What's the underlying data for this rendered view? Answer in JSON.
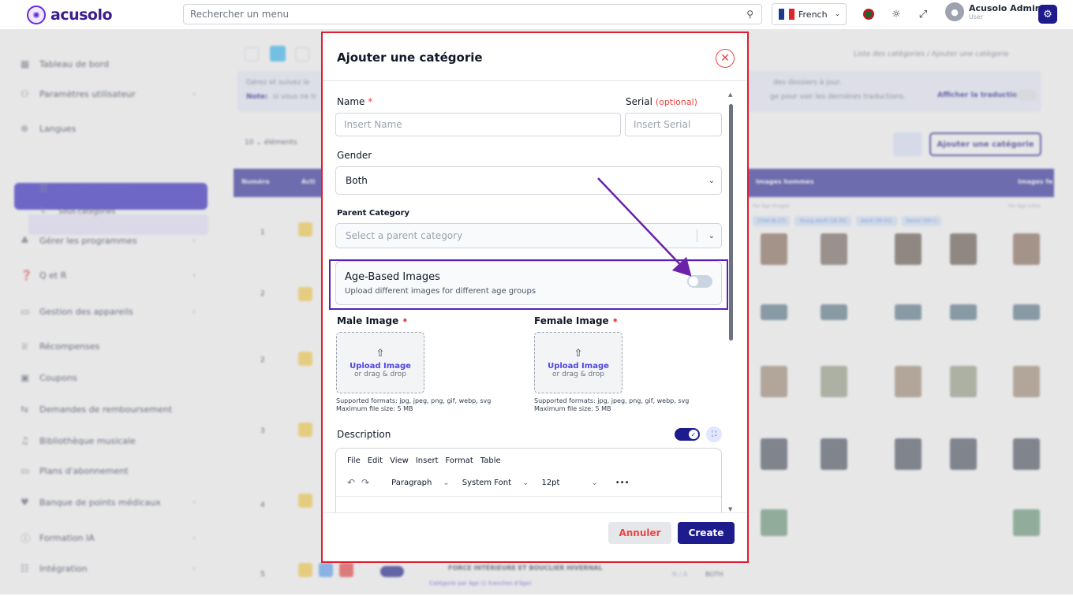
{
  "brand": {
    "name": "acusolo"
  },
  "search": {
    "placeholder": "Rechercher un menu"
  },
  "language": {
    "label": "French"
  },
  "user": {
    "name": "Acusolo Admin",
    "role": "User"
  },
  "sidebar": {
    "items": [
      {
        "label": "Tableau de bord"
      },
      {
        "label": "Paramètres utilisateur"
      },
      {
        "label": "Langues"
      },
      {
        "label": "Catégories"
      },
      {
        "label": "Liste des catégories"
      },
      {
        "label": "Sous-catégories"
      },
      {
        "label": "Gérer les programmes"
      },
      {
        "label": "Q et R"
      },
      {
        "label": "Gestion des appareils"
      },
      {
        "label": "Récompenses"
      },
      {
        "label": "Coupons"
      },
      {
        "label": "Demandes de remboursement"
      },
      {
        "label": "Bibliothèque musicale"
      },
      {
        "label": "Plans d'abonnement"
      },
      {
        "label": "Banque de points médicaux"
      },
      {
        "label": "Formation IA"
      },
      {
        "label": "Intégration"
      }
    ]
  },
  "main": {
    "breadcrumb": "Liste des catégories / Ajouter une catégorie",
    "info": "Gérez et suivez le",
    "info2": "des dossiers à jour.",
    "note": "Note:",
    "note_text": "si vous ne tr",
    "note_text2": "ge pour voir les dernières traductions.",
    "show_translation": "Afficher la traduction",
    "per_page": "10",
    "per_page_suffix": "éléments",
    "add_button": "Ajouter une catégorie",
    "columns": [
      "Numéro",
      "Acti",
      "Images hommes",
      "Images fe"
    ],
    "rows": [
      "1",
      "2",
      "2",
      "3",
      "4",
      "5"
    ],
    "age_header": "Par âge images",
    "age_header_right": "Par âge icône",
    "tags": [
      "Child (8-17)",
      "Young Adult (18-35)",
      "Adult (36-55)",
      "Senior (56+)"
    ],
    "row5_title": "FORCE INTÉRIEURE ET BOUCLIER HIVERNAL",
    "row5_sub": "Catégorie par âge (1 tranches d'âge)",
    "row5_serial": "N / A",
    "row5_gender": "BOTH"
  },
  "modal": {
    "title": "Ajouter une catégorie",
    "name_label": "Name",
    "name_required": "*",
    "name_placeholder": "Insert Name",
    "serial_label": "Serial",
    "serial_optional": "(optional)",
    "serial_placeholder": "Insert Serial",
    "gender_label": "Gender",
    "gender_value": "Both",
    "parent_label": "Parent Category",
    "parent_placeholder": "Select a parent category",
    "age_title": "Age-Based Images",
    "age_sub": "Upload different images for different age groups",
    "age_enabled": false,
    "male_label": "Male Image",
    "female_label": "Female Image",
    "required_dot": "•",
    "upload_title": "Upload Image",
    "upload_sub": "or drag & drop",
    "formats": "Supported formats: jpg, jpeg, png, gif, webp, svg",
    "maxsize": "Maximum file size: 5 MB",
    "description_label": "Description",
    "description_enabled": true,
    "editor_menu": [
      "File",
      "Edit",
      "View",
      "Insert",
      "Format",
      "Table"
    ],
    "editor_block": "Paragraph",
    "editor_font": "System Font",
    "editor_size": "12pt",
    "editor_more": "•••",
    "cancel": "Annuler",
    "create": "Create"
  },
  "colors": {
    "accent": "#1e1b8c",
    "danger": "#ef4444",
    "highlight": "#5b21b6",
    "frame": "#e11d2e"
  }
}
